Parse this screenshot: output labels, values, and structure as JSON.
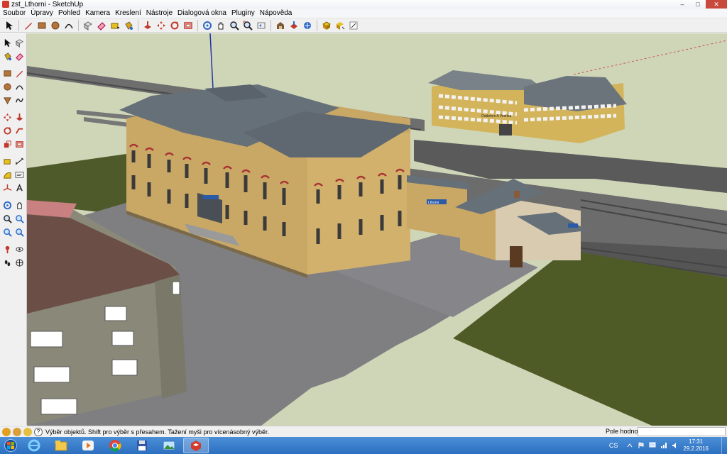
{
  "window": {
    "title": "zst_Lthorni - SketchUp"
  },
  "menu": {
    "items": [
      "Soubor",
      "Úpravy",
      "Pohled",
      "Kamera",
      "Kreslení",
      "Nástroje",
      "Dialogová okna",
      "Pluginy",
      "Nápověda"
    ]
  },
  "scene": {
    "sign_station": "Lthorni",
    "sign_shop": "Oddelem A Veshka"
  },
  "statusbar": {
    "hint": "Výběr objektů. Shift pro výběr s přesahem. Tažení myši pro vícenásobný výběr.",
    "measure_label": "Pole hodnot",
    "measure_value": ""
  },
  "taskbar": {
    "language": "CS",
    "time": "17:31",
    "date": "29.2.2016"
  },
  "colors": {
    "sky": "#cfd6b8",
    "grass": "#4e5a2a",
    "pavement": "#7f7f82",
    "facade": "#c9a866",
    "roof": "#667078",
    "taskbar": "#2c6fbf"
  }
}
